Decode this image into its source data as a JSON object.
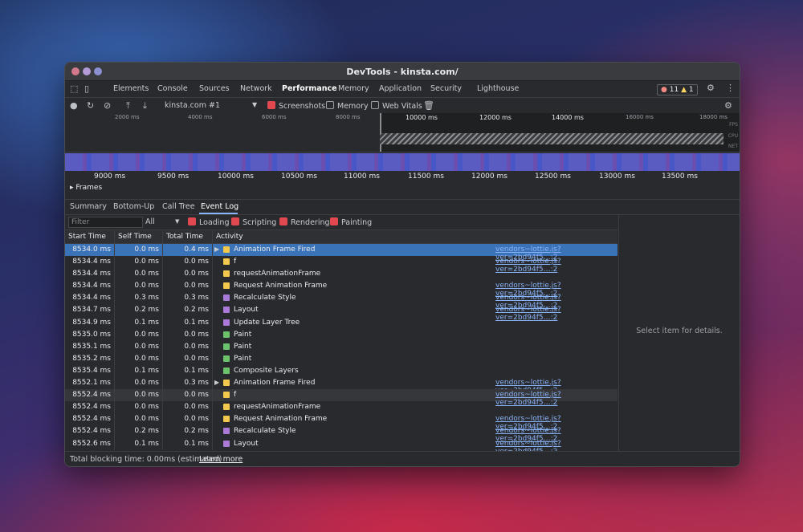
{
  "window": {
    "title": "DevTools - kinsta.com/"
  },
  "tabs": [
    "Elements",
    "Console",
    "Sources",
    "Network",
    "Performance",
    "Memory",
    "Application",
    "Security",
    "Lighthouse"
  ],
  "active_tab": "Performance",
  "issues": {
    "errors": "11",
    "warnings": "1"
  },
  "toolbar": {
    "profile_select": "kinsta.com #1",
    "screenshots_label": "Screenshots",
    "memory_label": "Memory",
    "web_vitals_label": "Web Vitals"
  },
  "overview": {
    "labels": [
      "2000 ms",
      "4000 ms",
      "6000 ms",
      "8000 ms",
      "10000 ms",
      "12000 ms",
      "14000 ms",
      "16000 ms",
      "18000 ms"
    ],
    "side_labels": [
      "FPS",
      "CPU",
      "NET"
    ]
  },
  "timeline_ticks": [
    "9000 ms",
    "9500 ms",
    "10000 ms",
    "10500 ms",
    "11000 ms",
    "11500 ms",
    "12000 ms",
    "12500 ms",
    "13000 ms",
    "13500 ms"
  ],
  "frames_label": "Frames",
  "subtabs": [
    "Summary",
    "Bottom-Up",
    "Call Tree",
    "Event Log"
  ],
  "active_subtab": "Event Log",
  "filters": {
    "placeholder": "Filter",
    "select": "All",
    "loading": "Loading",
    "scripting": "Scripting",
    "rendering": "Rendering",
    "painting": "Painting"
  },
  "columns": [
    "Start Time",
    "Self Time",
    "Total Time",
    "Activity"
  ],
  "colors": {
    "scripting": "#f2c94c",
    "rendering": "#a97bd6",
    "painting": "#6cc36c",
    "selected": "#3b73b9",
    "link": "#8ab4f8"
  },
  "rows": [
    {
      "start": "8534.0 ms",
      "self": "0.0 ms",
      "total": "0.4 ms",
      "activity": "Animation Frame Fired",
      "type": "scripting",
      "expand": true,
      "source": "vendors~lottie.js?ver=2bd94f5…:2"
    },
    {
      "start": "8534.4 ms",
      "self": "0.0 ms",
      "total": "0.0 ms",
      "activity": "f",
      "type": "scripting",
      "expand": false,
      "source": "vendors~lottie.js?ver=2bd94f5…:2"
    },
    {
      "start": "8534.4 ms",
      "self": "0.0 ms",
      "total": "0.0 ms",
      "activity": "requestAnimationFrame",
      "type": "scripting",
      "expand": false,
      "source": ""
    },
    {
      "start": "8534.4 ms",
      "self": "0.0 ms",
      "total": "0.0 ms",
      "activity": "Request Animation Frame",
      "type": "scripting",
      "expand": false,
      "source": "vendors~lottie.js?ver=2bd94f5…:2"
    },
    {
      "start": "8534.4 ms",
      "self": "0.3 ms",
      "total": "0.3 ms",
      "activity": "Recalculate Style",
      "type": "rendering",
      "expand": false,
      "source": "vendors~lottie.js?ver=2bd94f5…:2"
    },
    {
      "start": "8534.7 ms",
      "self": "0.2 ms",
      "total": "0.2 ms",
      "activity": "Layout",
      "type": "rendering",
      "expand": false,
      "source": "vendors~lottie.js?ver=2bd94f5…:2"
    },
    {
      "start": "8534.9 ms",
      "self": "0.1 ms",
      "total": "0.1 ms",
      "activity": "Update Layer Tree",
      "type": "rendering",
      "expand": false,
      "source": ""
    },
    {
      "start": "8535.0 ms",
      "self": "0.0 ms",
      "total": "0.0 ms",
      "activity": "Paint",
      "type": "painting",
      "expand": false,
      "source": ""
    },
    {
      "start": "8535.1 ms",
      "self": "0.0 ms",
      "total": "0.0 ms",
      "activity": "Paint",
      "type": "painting",
      "expand": false,
      "source": ""
    },
    {
      "start": "8535.2 ms",
      "self": "0.0 ms",
      "total": "0.0 ms",
      "activity": "Paint",
      "type": "painting",
      "expand": false,
      "source": ""
    },
    {
      "start": "8535.4 ms",
      "self": "0.1 ms",
      "total": "0.1 ms",
      "activity": "Composite Layers",
      "type": "painting",
      "expand": false,
      "source": ""
    },
    {
      "start": "8552.1 ms",
      "self": "0.0 ms",
      "total": "0.3 ms",
      "activity": "Animation Frame Fired",
      "type": "scripting",
      "expand": true,
      "source": "vendors~lottie.js?ver=2bd94f5…:2"
    },
    {
      "start": "8552.4 ms",
      "self": "0.0 ms",
      "total": "0.0 ms",
      "activity": "f",
      "type": "scripting",
      "expand": false,
      "source": "vendors~lottie.js?ver=2bd94f5…:2"
    },
    {
      "start": "8552.4 ms",
      "self": "0.0 ms",
      "total": "0.0 ms",
      "activity": "requestAnimationFrame",
      "type": "scripting",
      "expand": false,
      "source": ""
    },
    {
      "start": "8552.4 ms",
      "self": "0.0 ms",
      "total": "0.0 ms",
      "activity": "Request Animation Frame",
      "type": "scripting",
      "expand": false,
      "source": "vendors~lottie.js?ver=2bd94f5…:2"
    },
    {
      "start": "8552.4 ms",
      "self": "0.2 ms",
      "total": "0.2 ms",
      "activity": "Recalculate Style",
      "type": "rendering",
      "expand": false,
      "source": "vendors~lottie.js?ver=2bd94f5…:2"
    },
    {
      "start": "8552.6 ms",
      "self": "0.1 ms",
      "total": "0.1 ms",
      "activity": "Layout",
      "type": "rendering",
      "expand": false,
      "source": "vendors~lottie.js?ver=2bd94f5…:2"
    }
  ],
  "details": {
    "empty": "Select item for details."
  },
  "footer": {
    "text": "Total blocking time: 0.00ms (estimated)",
    "link": "Learn more"
  }
}
